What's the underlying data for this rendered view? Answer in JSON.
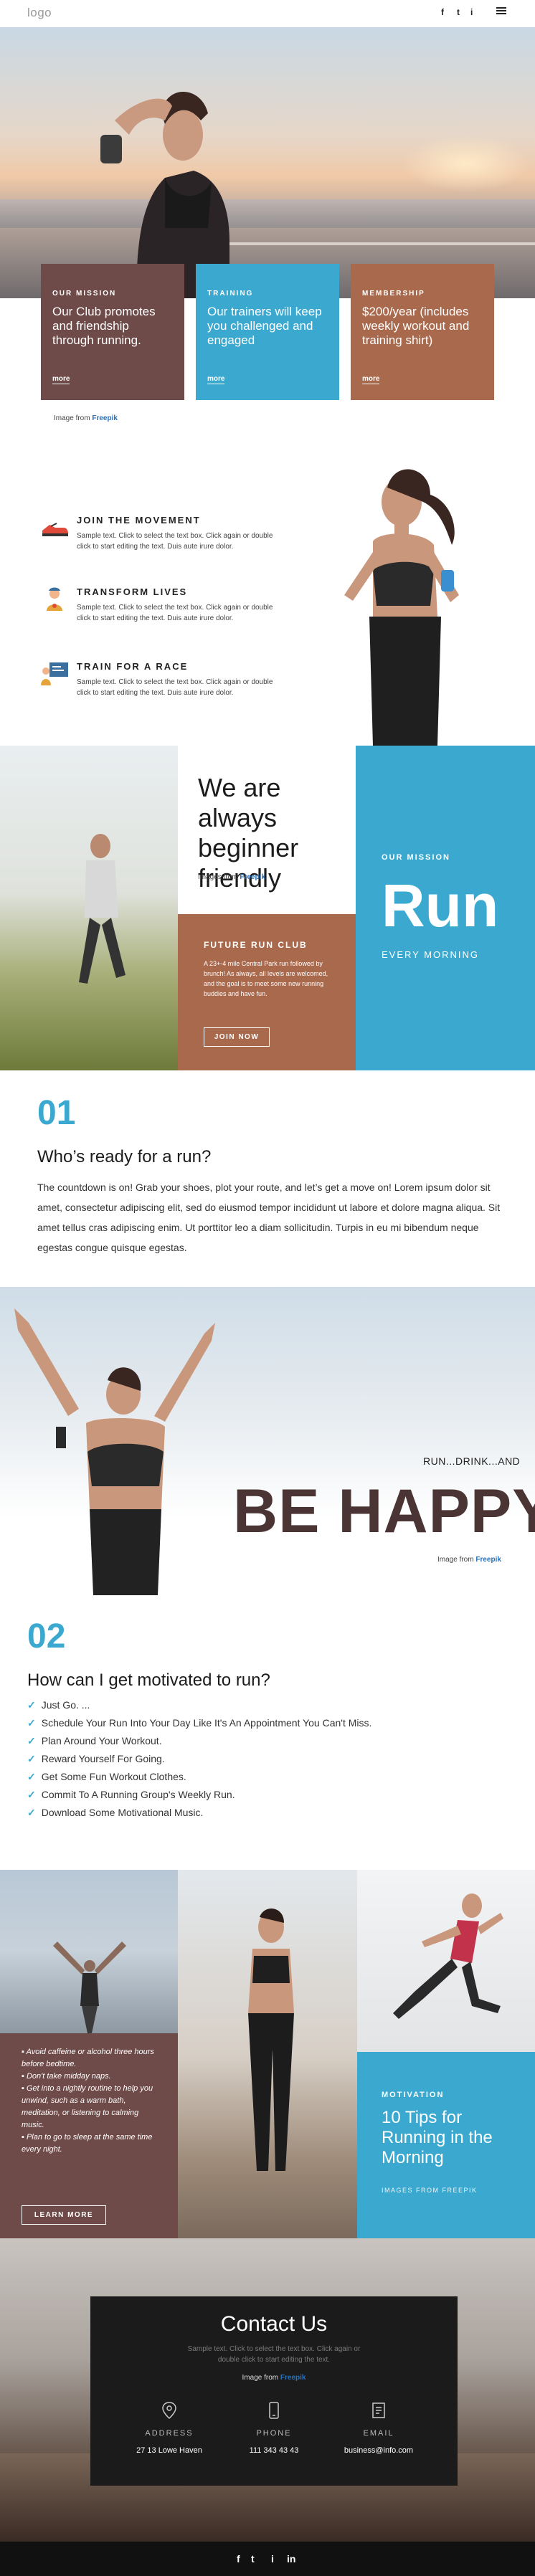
{
  "header": {
    "logo": "logo",
    "social": [
      "f",
      "t",
      "i"
    ]
  },
  "hero": {
    "cards": [
      {
        "label": "OUR MISSION",
        "text": "Our Club promotes and friendship through running.",
        "link": "more",
        "color": "#6e4a48"
      },
      {
        "label": "TRAINING",
        "text": "Our trainers will keep you challenged and engaged",
        "link": "more",
        "color": "#3aa8cf"
      },
      {
        "label": "MEMBERSHIP",
        "text": "$200/year (includes weekly workout and training shirt)",
        "link": "more",
        "color": "#a9694d"
      }
    ],
    "caption_prefix": "Image from",
    "caption_link": "Freepik"
  },
  "features": [
    {
      "title": "JOIN THE MOVEMENT",
      "text": "Sample text. Click to select the text box. Click again or double click to start editing the text. Duis aute irure dolor.",
      "icon": "running-shoe-icon"
    },
    {
      "title": "TRANSFORM LIVES",
      "text": "Sample text. Click to select the text box. Click again or double click to start editing the text. Duis aute irure dolor.",
      "icon": "person-medal-icon"
    },
    {
      "title": "TRAIN FOR A RACE",
      "text": "Sample text. Click to select the text box. Click again or double click to start editing the text. Duis aute irure dolor.",
      "icon": "trainer-board-icon"
    }
  ],
  "grid": {
    "beginner_heading": "We are always beginner friendly",
    "caption_prefix": "Images from",
    "caption_link": "Freepik",
    "mission_label": "OUR MISSION",
    "mission_big": "Run",
    "mission_sub": "EVERY MORNING",
    "future_title": "FUTURE RUN CLUB",
    "future_text": "A 23+-4 mile Central Park run followed by brunch! As always, all levels are welcomed, and the goal is to meet some new running buddies and have fun.",
    "join_button": "JOIN NOW"
  },
  "section01": {
    "number": "01",
    "heading": "Who’s ready for a run?",
    "paragraph": "The countdown is on! Grab your shoes, plot your route, and let’s get a move on! Lorem ipsum dolor sit amet, consectetur adipiscing elit, sed do eiusmod tempor incididunt ut labore et dolore magna aliqua. Sit amet tellus cras adipiscing enim. Ut porttitor leo a diam sollicitudin. Turpis in eu mi bibendum neque egestas congue quisque egestas."
  },
  "happy": {
    "small": "RUN...DRINK...AND",
    "big": "BE HAPPY!",
    "caption_prefix": "Image from",
    "caption_link": "Freepik"
  },
  "section02": {
    "number": "02",
    "heading": "How can I get motivated to run?",
    "items": [
      "Just Go. ...",
      "Schedule Your Run Into Your Day Like It's An Appointment You Can't Miss.",
      "Plan Around Your Workout.",
      "Reward Yourself For Going.",
      "Get Some Fun Workout Clothes.",
      "Commit To A Running Group's Weekly Run.",
      "Download Some Motivational Music."
    ]
  },
  "tips": {
    "list": [
      "Avoid caffeine or alcohol three hours before bedtime.",
      "Don't take midday naps.",
      "Get into a nightly routine to help you unwind, such as a warm bath, meditation, or listening to calming music.",
      "Plan to go to sleep at the same time every night."
    ],
    "learn_button": "LEARN MORE",
    "motivation_label": "MOTIVATION",
    "motivation_heading": "10 Tips for Running in the Morning",
    "motivation_caption": "IMAGES FROM FREEPIK"
  },
  "contact": {
    "title": "Contact Us",
    "text": "Sample text. Click to select the text box. Click again or double click to start editing the text.",
    "caption_prefix": "Image from",
    "caption_link": "Freepik",
    "items": [
      {
        "label": "ADDRESS",
        "value": "27 13 Lowe Haven",
        "icon": "location-pin-icon"
      },
      {
        "label": "PHONE",
        "value": "111 343 43 43",
        "icon": "phone-icon"
      },
      {
        "label": "EMAIL",
        "value": "business@info.com",
        "icon": "email-icon"
      }
    ]
  },
  "footer": {
    "social": [
      "f",
      "t",
      "i",
      "in"
    ]
  },
  "colors": {
    "brown_dark": "#6e4a48",
    "blue": "#3aa8cf",
    "rust": "#a9694d",
    "happy_text": "#4a3434"
  }
}
